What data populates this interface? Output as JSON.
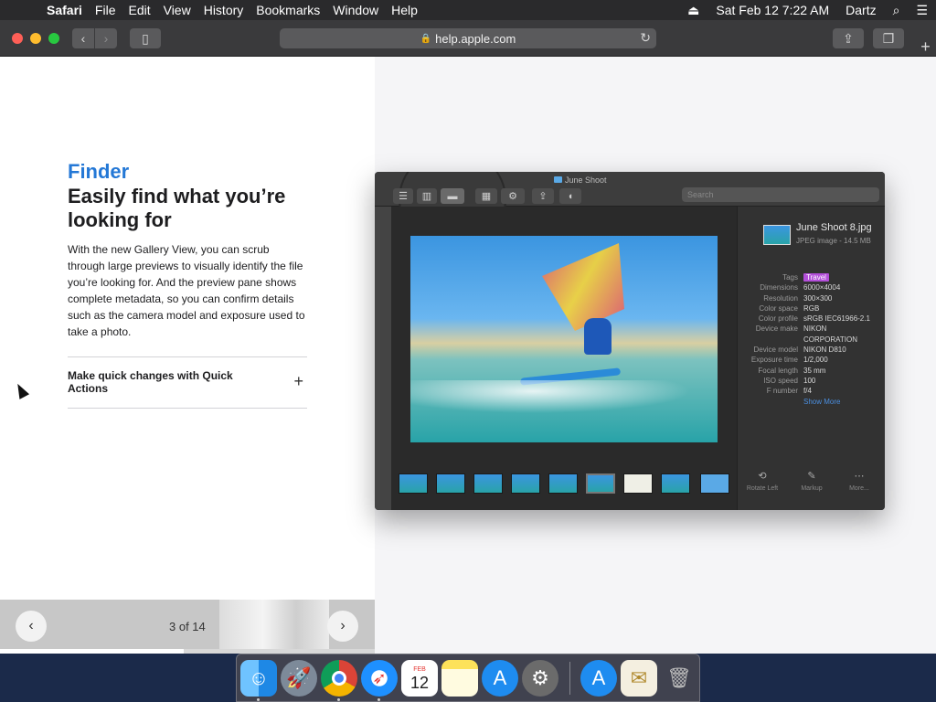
{
  "menubar": {
    "app": "Safari",
    "items": [
      "File",
      "Edit",
      "View",
      "History",
      "Bookmarks",
      "Window",
      "Help"
    ],
    "datetime": "Sat Feb 12  7:22 AM",
    "user": "Dartz"
  },
  "toolbar": {
    "url": "help.apple.com"
  },
  "article": {
    "eyebrow": "Finder",
    "headline": "Easily find what you’re looking for",
    "description": "With the new Gallery View, you can scrub through large previews to visually identify the file you’re looking for. And the preview pane shows complete metadata, so you can confirm details such as the camera model and exposure used to take a photo.",
    "accordion_label": "Make quick changes with Quick Actions"
  },
  "pager": {
    "counter": "3 of 14",
    "progress": 0.49
  },
  "finder": {
    "window_title": "June Shoot",
    "search_placeholder": "Search",
    "file_name": "June Shoot 8.jpg",
    "file_sub": "JPEG image - 14.5 MB",
    "metadata": [
      {
        "key": "Tags",
        "value": "Travel"
      },
      {
        "key": "Dimensions",
        "value": "6000×4004"
      },
      {
        "key": "Resolution",
        "value": "300×300"
      },
      {
        "key": "Color space",
        "value": "RGB"
      },
      {
        "key": "Color profile",
        "value": "sRGB IEC61966-2.1"
      },
      {
        "key": "Device make",
        "value": "NIKON CORPORATION"
      },
      {
        "key": "Device model",
        "value": "NIKON D810"
      },
      {
        "key": "Exposure time",
        "value": "1/2,000"
      },
      {
        "key": "Focal length",
        "value": "35 mm"
      },
      {
        "key": "ISO speed",
        "value": "100"
      },
      {
        "key": "F number",
        "value": "f/4"
      }
    ],
    "show_more": "Show More",
    "actions": [
      "Rotate Left",
      "Markup",
      "More..."
    ]
  },
  "dock": {
    "apps": [
      "Finder",
      "Launchpad",
      "Google Chrome",
      "Safari",
      "Calendar",
      "Notes",
      "App Store",
      "System Preferences",
      "App Store Downloads",
      "Certificate",
      "Trash"
    ],
    "calendar_month": "FEB",
    "calendar_day": "12"
  },
  "colors": {
    "accent_blue": "#2478d6",
    "tag_purple": "#b34fd9"
  }
}
